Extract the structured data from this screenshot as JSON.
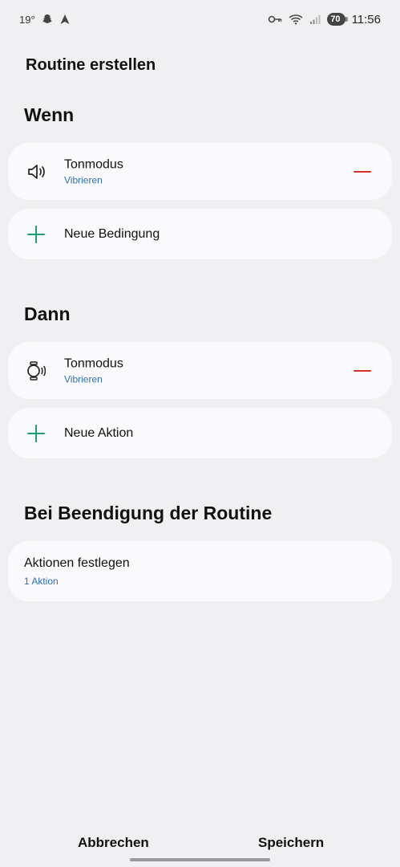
{
  "status_bar": {
    "temperature": "19°",
    "battery": "70",
    "time": "11:56",
    "icons": [
      "snapchat-icon",
      "navigation-icon",
      "key-icon",
      "wifi-icon",
      "signal-icon"
    ]
  },
  "page": {
    "title": "Routine erstellen"
  },
  "when": {
    "header": "Wenn",
    "condition": {
      "title": "Tonmodus",
      "subtitle": "Vibrieren",
      "icon": "speaker-icon"
    },
    "add_label": "Neue Bedingung"
  },
  "then": {
    "header": "Dann",
    "action": {
      "title": "Tonmodus",
      "subtitle": "Vibrieren",
      "icon": "watch-vibrate-icon"
    },
    "add_label": "Neue Aktion"
  },
  "on_end": {
    "header": "Bei Beendigung der Routine",
    "title": "Aktionen festlegen",
    "subtitle": "1 Aktion"
  },
  "footer": {
    "cancel": "Abbrechen",
    "save": "Speichern"
  },
  "colors": {
    "background": "#f0f0f3",
    "card": "#fafafc",
    "accent_green": "#1f9d6a",
    "remove_red": "#d93025",
    "link_blue": "#2f6db6"
  }
}
